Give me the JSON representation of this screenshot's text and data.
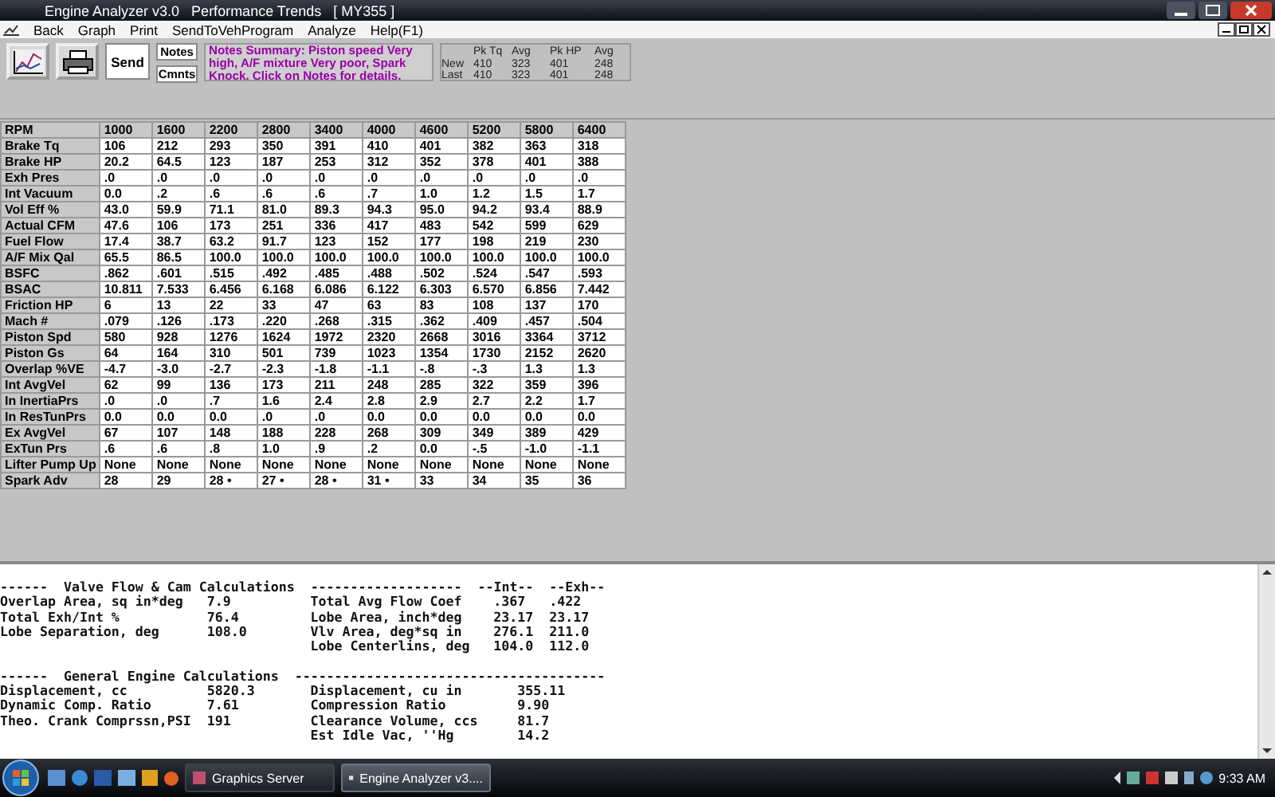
{
  "window": {
    "title": "Engine Analyzer v3.0   Performance Trends   [ MY355 ]"
  },
  "menu": [
    "Back",
    "Graph",
    "Print",
    "SendToVehProgram",
    "Analyze",
    "Help(F1)"
  ],
  "toolbar": {
    "send": "Send",
    "notes": "Notes",
    "comments": "Cmnts",
    "summary": "Notes Summary:  Piston speed Very high, A/F mixture Very poor, Spark Knock. Click on Notes for details."
  },
  "peaks": {
    "columns": [
      "Pk Tq",
      "Avg",
      "Pk HP",
      "Avg"
    ],
    "rows": [
      {
        "label": "New",
        "values": [
          "410",
          "323",
          "401",
          "248"
        ]
      },
      {
        "label": "Last",
        "values": [
          "410",
          "323",
          "401",
          "248"
        ]
      }
    ]
  },
  "table": {
    "header": {
      "label": "RPM",
      "values": [
        "1000",
        "1600",
        "2200",
        "2800",
        "3400",
        "4000",
        "4600",
        "5200",
        "5800",
        "6400"
      ]
    },
    "rows": [
      {
        "label": "Brake Tq",
        "values": [
          "106",
          "212",
          "293",
          "350",
          "391",
          "410",
          "401",
          "382",
          "363",
          "318"
        ]
      },
      {
        "label": "Brake HP",
        "values": [
          "20.2",
          "64.5",
          "123",
          "187",
          "253",
          "312",
          "352",
          "378",
          "401",
          "388"
        ]
      },
      {
        "label": "Exh Pres",
        "values": [
          ".0",
          ".0",
          ".0",
          ".0",
          ".0",
          ".0",
          ".0",
          ".0",
          ".0",
          ".0"
        ]
      },
      {
        "label": "Int Vacuum",
        "values": [
          "0.0",
          ".2",
          ".6",
          ".6",
          ".6",
          ".7",
          "1.0",
          "1.2",
          "1.5",
          "1.7"
        ]
      },
      {
        "label": "Vol Eff %",
        "values": [
          "43.0",
          "59.9",
          "71.1",
          "81.0",
          "89.3",
          "94.3",
          "95.0",
          "94.2",
          "93.4",
          "88.9"
        ]
      },
      {
        "label": "Actual CFM",
        "values": [
          "47.6",
          "106",
          "173",
          "251",
          "336",
          "417",
          "483",
          "542",
          "599",
          "629"
        ]
      },
      {
        "label": "Fuel Flow",
        "values": [
          "17.4",
          "38.7",
          "63.2",
          "91.7",
          "123",
          "152",
          "177",
          "198",
          "219",
          "230"
        ]
      },
      {
        "label": "A/F Mix Qal",
        "values": [
          "65.5",
          "86.5",
          "100.0",
          "100.0",
          "100.0",
          "100.0",
          "100.0",
          "100.0",
          "100.0",
          "100.0"
        ]
      },
      {
        "label": "BSFC",
        "values": [
          ".862",
          ".601",
          ".515",
          ".492",
          ".485",
          ".488",
          ".502",
          ".524",
          ".547",
          ".593"
        ]
      },
      {
        "label": "BSAC",
        "values": [
          "10.811",
          "7.533",
          "6.456",
          "6.168",
          "6.086",
          "6.122",
          "6.303",
          "6.570",
          "6.856",
          "7.442"
        ]
      },
      {
        "label": "Friction HP",
        "values": [
          "6",
          "13",
          "22",
          "33",
          "47",
          "63",
          "83",
          "108",
          "137",
          "170"
        ]
      },
      {
        "label": "Mach #",
        "values": [
          ".079",
          ".126",
          ".173",
          ".220",
          ".268",
          ".315",
          ".362",
          ".409",
          ".457",
          ".504"
        ]
      },
      {
        "label": "Piston Spd",
        "values": [
          "580",
          "928",
          "1276",
          "1624",
          "1972",
          "2320",
          "2668",
          "3016",
          "3364",
          "3712"
        ]
      },
      {
        "label": "Piston Gs",
        "values": [
          "64",
          "164",
          "310",
          "501",
          "739",
          "1023",
          "1354",
          "1730",
          "2152",
          "2620"
        ]
      },
      {
        "label": "Overlap %VE",
        "values": [
          "-4.7",
          "-3.0",
          "-2.7",
          "-2.3",
          "-1.8",
          "-1.1",
          "-.8",
          "-.3",
          "1.3",
          "1.3"
        ]
      },
      {
        "label": "Int AvgVel",
        "values": [
          "62",
          "99",
          "136",
          "173",
          "211",
          "248",
          "285",
          "322",
          "359",
          "396"
        ]
      },
      {
        "label": "In InertiaPrs",
        "values": [
          ".0",
          ".0",
          ".7",
          "1.6",
          "2.4",
          "2.8",
          "2.9",
          "2.7",
          "2.2",
          "1.7"
        ]
      },
      {
        "label": "In ResTunPrs",
        "values": [
          "0.0",
          "0.0",
          "0.0",
          ".0",
          ".0",
          "0.0",
          "0.0",
          "0.0",
          "0.0",
          "0.0"
        ]
      },
      {
        "label": "Ex AvgVel",
        "values": [
          "67",
          "107",
          "148",
          "188",
          "228",
          "268",
          "309",
          "349",
          "389",
          "429"
        ]
      },
      {
        "label": "ExTun Prs",
        "values": [
          ".6",
          ".6",
          ".8",
          "1.0",
          ".9",
          ".2",
          "0.0",
          "-.5",
          "-1.0",
          "-1.1"
        ]
      },
      {
        "label": "Lifter Pump Up",
        "values": [
          "None",
          "None",
          "None",
          "None",
          "None",
          "None",
          "None",
          "None",
          "None",
          "None"
        ]
      },
      {
        "label": "Spark Adv",
        "values": [
          "28",
          "29",
          "28 •",
          "27 •",
          "28 •",
          "31 •",
          "33",
          "34",
          "35",
          "36"
        ]
      }
    ]
  },
  "report": {
    "valve": {
      "title": "------  Valve Flow & Cam Calculations",
      "rule": "-------------------",
      "int_head": "--Int--",
      "exh_head": "--Exh--",
      "left": [
        {
          "label": "Overlap Area, sq in*deg",
          "value": "7.9"
        },
        {
          "label": "Total Exh/Int %",
          "value": "76.4"
        },
        {
          "label": "Lobe Separation, deg",
          "value": "108.0"
        }
      ],
      "right": [
        {
          "label": "Total Avg Flow Coef",
          "int": ".367",
          "exh": ".422"
        },
        {
          "label": "Lobe Area, inch*deg",
          "int": "23.17",
          "exh": "23.17"
        },
        {
          "label": "Vlv Area, deg*sq in",
          "int": "276.1",
          "exh": "211.0"
        },
        {
          "label": "Lobe Centerlins, deg",
          "int": "104.0",
          "exh": "112.0"
        }
      ]
    },
    "general": {
      "title": "------  General Engine Calculations",
      "rule": "---------------------------------------",
      "left": [
        {
          "label": "Displacement, cc",
          "value": "5820.3"
        },
        {
          "label": "Dynamic Comp. Ratio",
          "value": "7.61"
        },
        {
          "label": "Theo. Crank Comprssn,PSI",
          "value": "191"
        }
      ],
      "right": [
        {
          "label": "Displacement, cu in",
          "value": "355.11"
        },
        {
          "label": "Compression Ratio",
          "value": "9.90"
        },
        {
          "label": "Clearance Volume, ccs",
          "value": "81.7"
        },
        {
          "label": "Est Idle Vac, ''Hg",
          "value": "14.2"
        }
      ]
    }
  },
  "taskbar": {
    "items": [
      {
        "label": "Graphics Server",
        "selected": false
      },
      {
        "label": "Engine Analyzer v3....",
        "selected": true
      }
    ],
    "clock": "9:33 AM"
  }
}
